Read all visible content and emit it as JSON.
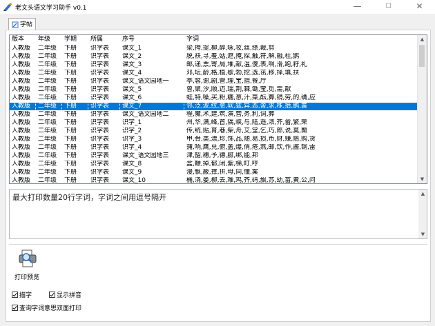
{
  "window": {
    "title": "老文头语文学习助手 v0.1",
    "minimize": "—",
    "maximize": "☐",
    "close": "✕"
  },
  "tab": {
    "label": "字帖"
  },
  "table": {
    "headers": [
      "版本",
      "年级",
      "学期",
      "所属",
      "序号",
      "字词"
    ],
    "rows": [
      [
        "人教版",
        "二年级",
        "下册",
        "识字表",
        "课文_1",
        "梁,挎,提,柳,醉,咏,妆,丝,绦,裁,剪"
      ],
      [
        "人教版",
        "二年级",
        "下册",
        "识字表",
        "课文_2",
        "脱,袄,寻,羞,姑,遮,掩,探,触,符,解,融,柱,鹅"
      ],
      [
        "人教版",
        "二年级",
        "下册",
        "识字表",
        "课文_3",
        "邮,递,票,寄,局,堆,献,温,傻,表,啊,滑,跑,籽,礼"
      ],
      [
        "人教版",
        "二年级",
        "下册",
        "识字表",
        "课文_4",
        "邓,坛,龄,格,植,歇,勃,挖,选,茁,移,择,填,扶"
      ],
      [
        "人教版",
        "二年级",
        "下册",
        "识字表",
        "课文_语文园地一",
        "亭,容,谢,剧,管,理,宝,指,餐,厅"
      ],
      [
        "人教版",
        "二年级",
        "下册",
        "识字表",
        "课文_5",
        "曾,聚,汐,顺,迈,瑞,荆,棘,锄,莹,觅,需,献"
      ],
      [
        "人教版",
        "二年级",
        "下册",
        "识字表",
        "课文_6",
        "蛙,特,嗓,买,粉,糖,葱,汁,菜,酝,算,镜,劳,的,确,应"
      ],
      [
        "人教版",
        "二年级",
        "下册",
        "识字表",
        "课文_7",
        "邻,泛,波,纹,葱,软,猛,异,态,舍,求,株,抬,鹅,簧"
      ],
      [
        "人教版",
        "二年级",
        "下册",
        "识字表",
        "课文_语文园地二",
        "程,魔,术,建,筑,演,营,务,利,词,葬"
      ],
      [
        "人教版",
        "二年级",
        "下册",
        "识字表",
        "识字_1",
        "州,华,满,峰,首,隅,峡,与,陆,遥,浓,齐,畲,繁,荣"
      ],
      [
        "人教版",
        "二年级",
        "下册",
        "识字表",
        "识字_2",
        "传,统,贴,育,巷,柴,舟,艾,堂,乞,巧,郎,说,莫,蘭"
      ],
      [
        "人教版",
        "二年级",
        "下册",
        "识字表",
        "识字_3",
        "甲,骨,类,漂,珍,饰,品,随,易,损,币,财,赚,赔,购,货"
      ],
      [
        "人教版",
        "二年级",
        "下册",
        "识字表",
        "识字_4",
        "蒲,响,鹰,兑,俯,盖,爆,俏,疮,燕,邮,饮,作,酱,钢,雷"
      ],
      [
        "人教版",
        "二年级",
        "下册",
        "识字表",
        "课文_语文园地三",
        "津,韶,穗,予,德,腻,绑,能,邦"
      ],
      [
        "人教版",
        "二年级",
        "下册",
        "识字表",
        "课文_8",
        "盒,鞭,掉,郁,闭,紫,梯,盯,哼"
      ],
      [
        "人教版",
        "二年级",
        "下册",
        "识字表",
        "课文_9",
        "漫,飘,蔽,撑,拼,母,同,懂,案"
      ],
      [
        "人教版",
        "二年级",
        "下册",
        "识字表",
        "课文_10",
        "桶,浇,娄,柳,去,难,鸡,齐,码,飘,苏,幼,苗,黄,公,问"
      ]
    ],
    "selected_index": 7
  },
  "input": {
    "placeholder": "最大打印数量20行字词，字词之间用逗号隔开",
    "value": ""
  },
  "print_button": {
    "label": "打印预览"
  },
  "options": [
    {
      "label": "描字",
      "checked": true
    },
    {
      "label": "显示拼音",
      "checked": true
    },
    {
      "label": "查询字词意思双面打印",
      "checked": true
    }
  ],
  "colors": {
    "selection": "#0078d7",
    "window_bg": "#f0f0f0"
  }
}
